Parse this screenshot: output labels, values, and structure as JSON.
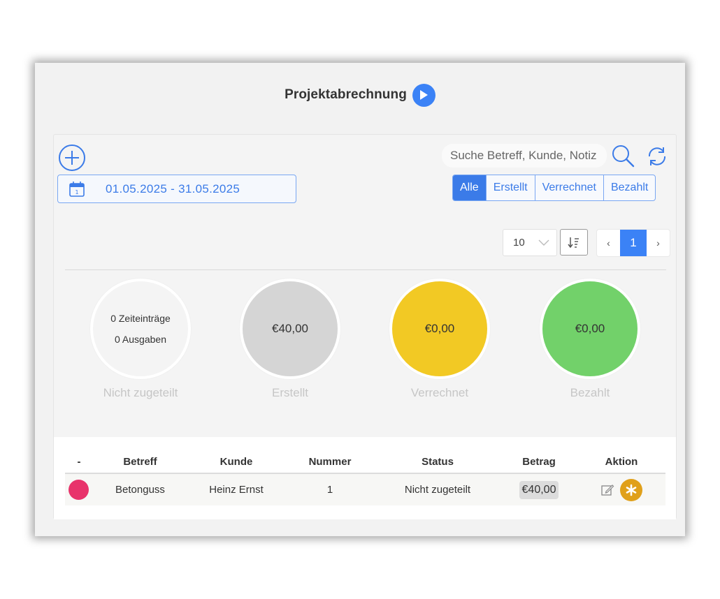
{
  "header": {
    "title": "Projektabrechnung"
  },
  "toolbar": {
    "date_range": "01.05.2025 - 31.05.2025",
    "search_placeholder": "Suche Betreff, Kunde, Notiz",
    "filters": [
      {
        "label": "Alle",
        "active": true
      },
      {
        "label": "Erstellt",
        "active": false
      },
      {
        "label": "Verrechnet",
        "active": false
      },
      {
        "label": "Bezahlt",
        "active": false
      }
    ]
  },
  "pager": {
    "page_size": "10",
    "prev": "‹",
    "current_page": "1",
    "next": "›"
  },
  "stats": [
    {
      "label": "Nicht zugeteilt",
      "line1": "0 Zeiteinträge",
      "line2": "0 Ausgaben",
      "color": "#f4f4f4"
    },
    {
      "label": "Erstellt",
      "value": "€40,00",
      "color": "#d5d5d5"
    },
    {
      "label": "Verrechnet",
      "value": "€0,00",
      "color": "#f2c924"
    },
    {
      "label": "Bezahlt",
      "value": "€0,00",
      "color": "#72d16a"
    }
  ],
  "table": {
    "headers": [
      "-",
      "Betreff",
      "Kunde",
      "Nummer",
      "Status",
      "Betrag",
      "Aktion"
    ],
    "rows": [
      {
        "status_color": "#e8336b",
        "betreff": "Betonguss",
        "kunde": "Heinz Ernst",
        "nummer": "1",
        "status": "Nicht zugeteilt",
        "betrag": "€40,00"
      }
    ]
  },
  "colors": {
    "accent": "#3b82f6",
    "action_orange": "#e0a01a"
  }
}
